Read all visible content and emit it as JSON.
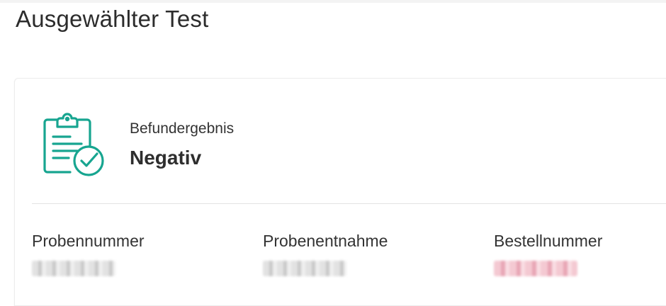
{
  "page": {
    "title": "Ausgewählter Test"
  },
  "result": {
    "label": "Befundergebnis",
    "value": "Negativ",
    "icon": "clipboard-check-icon",
    "icon_color": "#17a590"
  },
  "details": {
    "sample_number_label": "Probennummer",
    "sample_collection_label": "Probenentnahme",
    "order_number_label": "Bestellnummer"
  }
}
